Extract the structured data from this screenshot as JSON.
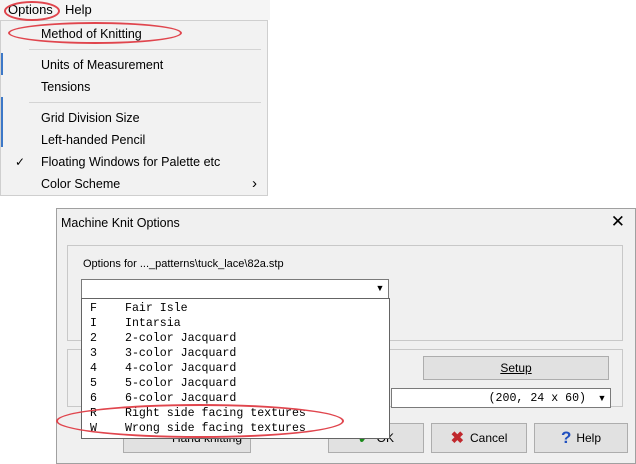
{
  "menubar": {
    "options_label": "Options",
    "help_label": "Help"
  },
  "menu": {
    "method": "Method of Knitting",
    "units": "Units of Measurement",
    "tensions": "Tensions",
    "grid": "Grid Division Size",
    "lefthanded": "Left-handed Pencil",
    "floating": "Floating Windows for Palette etc",
    "color_scheme": "Color Scheme",
    "check_glyph": "✓",
    "submenu_glyph": "›"
  },
  "dialog": {
    "title": "Machine Knit Options",
    "close_glyph": "✕",
    "options_for": "Options for ..._patterns\\tuck_lace\\82a.stp",
    "combo_value": "",
    "setup_label": "Setup",
    "stitch_value": "(200, 24 x  60)",
    "hand_knitting_label": "Hand knitting",
    "ok_label": "OK",
    "cancel_label": "Cancel",
    "help_label": "Help",
    "list": [
      {
        "code": "F",
        "name": "Fair Isle"
      },
      {
        "code": "I",
        "name": "Intarsia"
      },
      {
        "code": "2",
        "name": "2-color Jacquard"
      },
      {
        "code": "3",
        "name": "3-color Jacquard"
      },
      {
        "code": "4",
        "name": "4-color Jacquard"
      },
      {
        "code": "5",
        "name": "5-color Jacquard"
      },
      {
        "code": "6",
        "name": "6-color Jacquard"
      },
      {
        "code": "R",
        "name": "Right side facing textures"
      },
      {
        "code": "W",
        "name": "Wrong side facing textures"
      }
    ]
  },
  "colors": {
    "highlight": "#e0454d",
    "accent": "#3c78c8",
    "cancel_x": "#c0282d",
    "help_q": "#2050c0",
    "ok_check": "#1a8a1a"
  }
}
